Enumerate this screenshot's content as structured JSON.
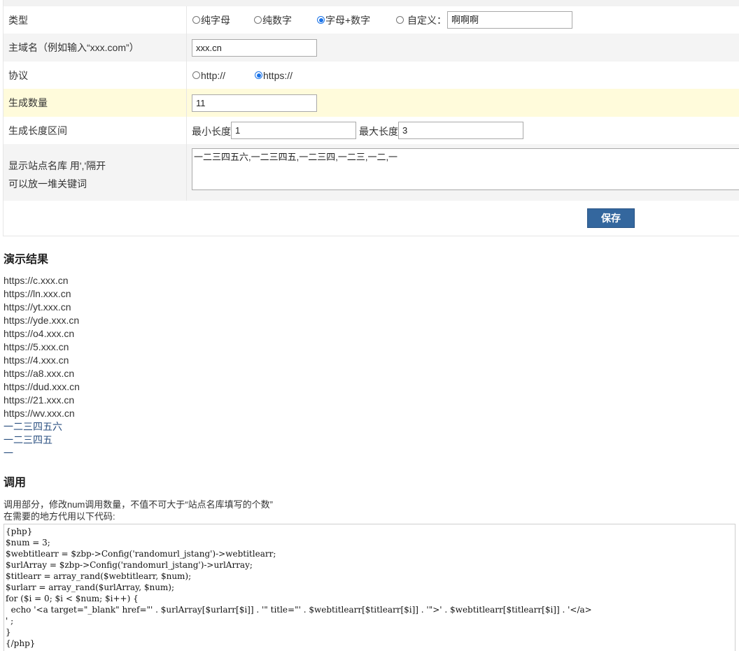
{
  "form": {
    "type_row": {
      "label": "类型",
      "options": [
        "纯字母",
        "纯数字",
        "字母+数字",
        "自定义："
      ],
      "selected": "字母+数字",
      "custom_value": "啊啊啊"
    },
    "domain_row": {
      "label": "主域名（例如输入“xxx.com”）",
      "value": "xxx.cn"
    },
    "protocol_row": {
      "label": "协议",
      "options": [
        "http://",
        "https://"
      ],
      "selected": "https://"
    },
    "count_row": {
      "label": "生成数量",
      "value": "11"
    },
    "length_row": {
      "label": "生成长度区间",
      "min_label": "最小长度",
      "min_value": "1",
      "max_label": "最大长度",
      "max_value": "3"
    },
    "names_row": {
      "label_line1": "显示站点名库 用','隔开",
      "label_line2": "可以放一堆关键词",
      "value": "一二三四五六,一二三四五,一二三四,一二三,一二,一"
    },
    "save_label": "保存"
  },
  "demo": {
    "title": "演示结果",
    "urls": [
      "https://c.xxx.cn",
      "https://ln.xxx.cn",
      "https://yt.xxx.cn",
      "https://yde.xxx.cn",
      "https://o4.xxx.cn",
      "https://5.xxx.cn",
      "https://4.xxx.cn",
      "https://a8.xxx.cn",
      "https://dud.xxx.cn",
      "https://21.xxx.cn",
      "https://wv.xxx.cn"
    ],
    "links": [
      "一二三四五六",
      "一二三四五",
      "一"
    ]
  },
  "usage": {
    "title": "调用",
    "desc_line1": "调用部分，修改num调用数量，不值不可大于“站点名库填写的个数”",
    "desc_line2": "在需要的地方代用以下代码:",
    "code_lines": [
      "{php}",
      "$num = 3;",
      "$webtitlearr = $zbp->Config('randomurl_jstang')->webtitlearr;",
      "$urlArray = $zbp->Config('randomurl_jstang')->urlArray;",
      "$titlearr = array_rand($webtitlearr, $num);",
      "$urlarr = array_rand($urlArray, $num);",
      "for ($i = 0; $i < $num; $i++) {",
      "  echo '<a target=\"_blank\" href=\"' . $urlArray[$urlarr[$i]] . '\" title=\"' . $webtitlearr[$titlearr[$i]] . '\">' . $webtitlearr[$titlearr[$i]] . '</a>",
      "' ;",
      "}",
      "{/php}"
    ]
  }
}
